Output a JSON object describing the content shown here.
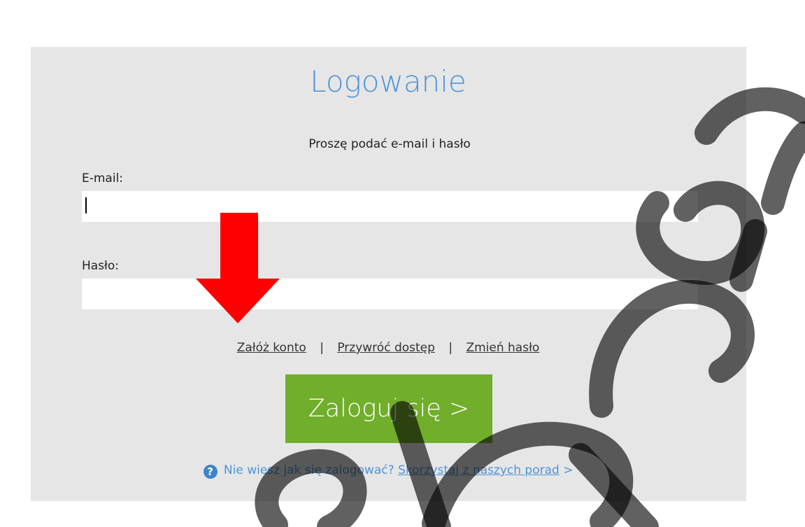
{
  "login": {
    "title": "Logowanie",
    "subtitle": "Proszę podać e-mail i hasło",
    "email_label": "E-mail:",
    "email_value": "",
    "password_label": "Hasło:",
    "password_value": "",
    "links": {
      "create_account": "Załóż konto",
      "separator": "|",
      "restore_access": "Przywróć dostęp",
      "change_password": "Zmień hasło"
    },
    "submit_label": "Zaloguj się >",
    "help": {
      "icon": "question-circle-icon",
      "icon_glyph": "?",
      "text": "Nie wiesz jak się zalogować?",
      "link_text": "Skorzystaj z naszych porad",
      "suffix": ">"
    }
  },
  "annotation": {
    "arrow_icon": "red-down-arrow-icon",
    "arrow_color": "#ff0000"
  },
  "colors": {
    "panel_background": "#e6e6e6",
    "accent_blue": "#4f95d6",
    "button_green": "#71ae2b"
  }
}
